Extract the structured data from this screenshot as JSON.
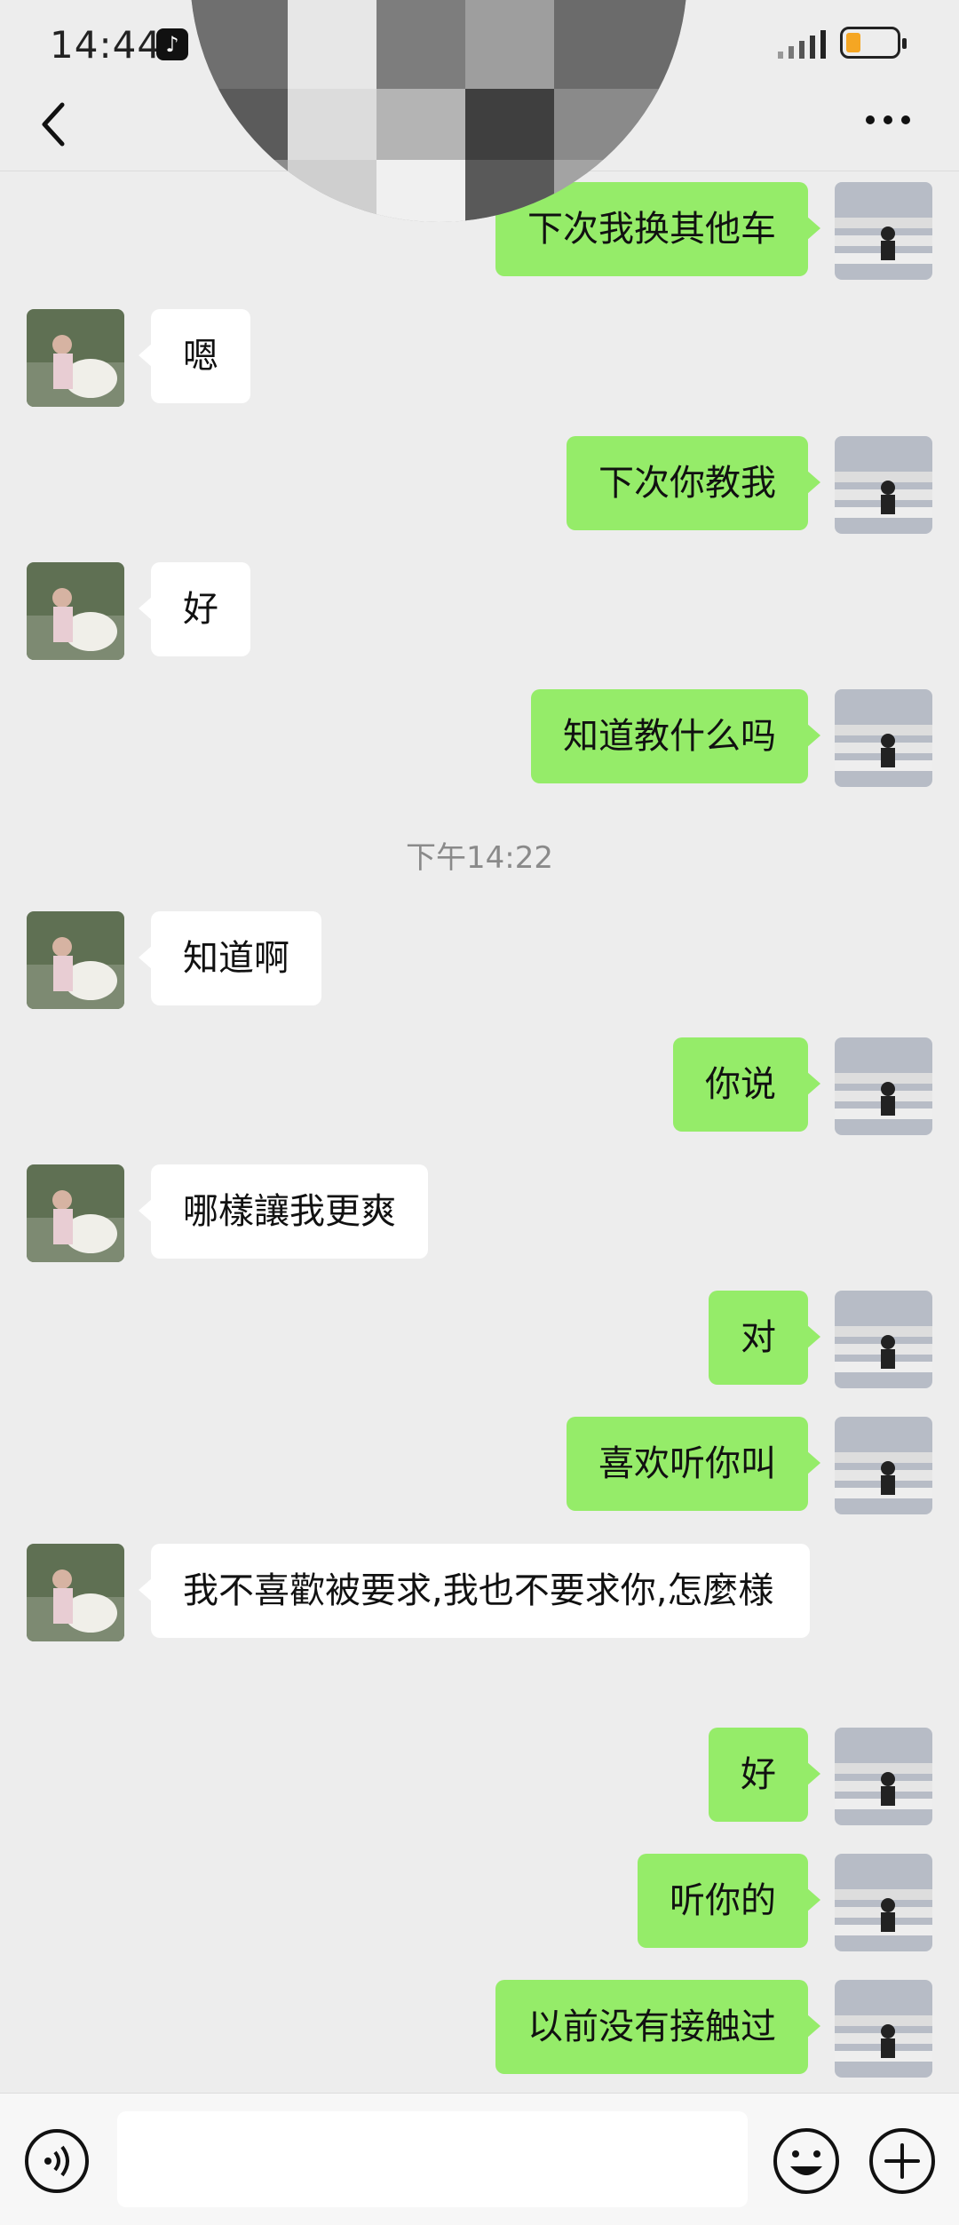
{
  "status_bar": {
    "time": "14:44",
    "battery_color": "#f5a623",
    "icons": [
      "tiktok-icon",
      "signal-icon",
      "battery-icon"
    ]
  },
  "nav": {
    "back_icon": "chevron-left-icon",
    "more_icon": "more-dots-icon"
  },
  "colors": {
    "outgoing_bubble": "#95ec69",
    "incoming_bubble": "#ffffff",
    "background": "#ededed"
  },
  "messages": [
    {
      "side": "out",
      "text": "下次我换其他车"
    },
    {
      "side": "in",
      "text": "嗯"
    },
    {
      "side": "out",
      "text": "下次你教我"
    },
    {
      "side": "in",
      "text": "好"
    },
    {
      "side": "out",
      "text": "知道教什么吗"
    },
    {
      "side": "time",
      "text": "下午14:22"
    },
    {
      "side": "in",
      "text": "知道啊"
    },
    {
      "side": "out",
      "text": "你说"
    },
    {
      "side": "in",
      "text": "哪樣讓我更爽"
    },
    {
      "side": "out",
      "text": "对"
    },
    {
      "side": "out",
      "text": "喜欢听你叫"
    },
    {
      "side": "in",
      "text": "我不喜歡被要求,我也不要求你,怎麼様"
    },
    {
      "side": "out",
      "text": "好"
    },
    {
      "side": "out",
      "text": "听你的"
    },
    {
      "side": "out",
      "text": "以前没有接触过"
    }
  ],
  "input_bar": {
    "voice_icon": "voice-icon",
    "emoji_icon": "emoji-icon",
    "plus_icon": "plus-icon",
    "input_value": ""
  }
}
